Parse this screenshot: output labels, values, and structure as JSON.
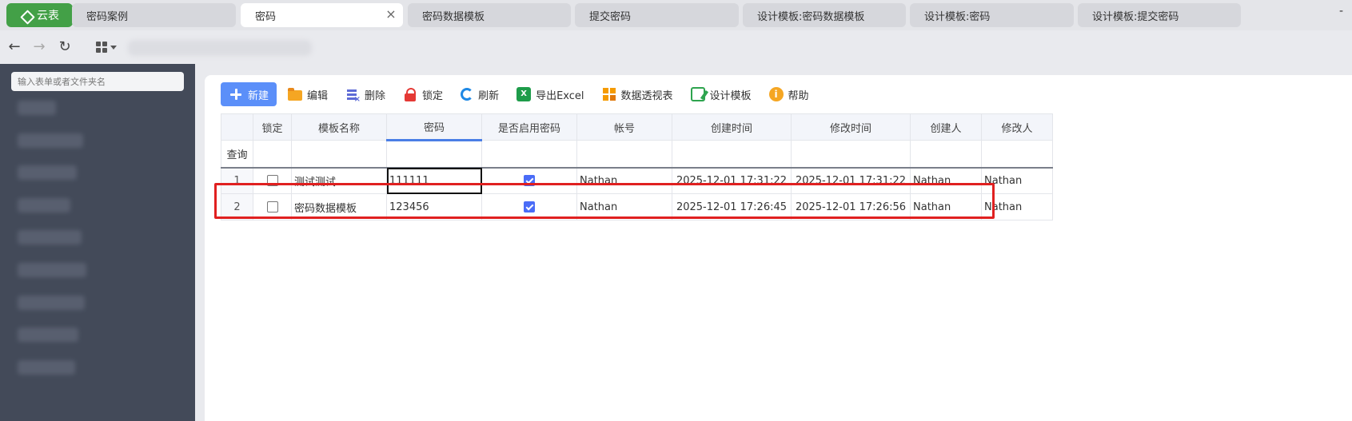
{
  "brand": {
    "label": "云表"
  },
  "tabs": [
    {
      "label": "密码案例",
      "active": false
    },
    {
      "label": "密码",
      "active": true
    },
    {
      "label": "密码数据模板",
      "active": false
    },
    {
      "label": "提交密码",
      "active": false
    },
    {
      "label": "设计模板:密码数据模板",
      "active": false
    },
    {
      "label": "设计模板:密码",
      "active": false
    },
    {
      "label": "设计模板:提交密码",
      "active": false
    }
  ],
  "tab_more": "-",
  "nav": {
    "back_icon": "back-arrow-icon",
    "forward_icon": "forward-arrow-icon",
    "reload_icon": "reload-icon",
    "apps_icon": "apps-grid-icon"
  },
  "sidebar": {
    "search_placeholder": "输入表单或者文件夹名"
  },
  "toolbar": {
    "new": "新建",
    "edit": "编辑",
    "delete": "删除",
    "lock": "锁定",
    "refresh": "刷新",
    "export": "导出Excel",
    "pivot": "数据透视表",
    "design": "设计模板",
    "help": "帮助"
  },
  "table": {
    "headers": [
      "锁定",
      "模板名称",
      "密码",
      "是否启用密码",
      "帐号",
      "创建时间",
      "修改时间",
      "创建人",
      "修改人"
    ],
    "filter_label": "查询",
    "rows": [
      {
        "num": "1",
        "locked": false,
        "name": "测试测试",
        "password": "111111",
        "enabled": true,
        "account": "Nathan",
        "created": "2025-12-01 17:31:22",
        "modified": "2025-12-01 17:31:22",
        "creator": "Nathan",
        "modifier": "Nathan"
      },
      {
        "num": "2",
        "locked": false,
        "name": "密码数据模板",
        "password": "123456",
        "enabled": true,
        "account": "Nathan",
        "created": "2025-12-01 17:26:45",
        "modified": "2025-12-01 17:26:56",
        "creator": "Nathan",
        "modifier": "Nathan"
      }
    ]
  },
  "colors": {
    "brand": "#43a047",
    "primary": "#5b8ff9",
    "highlight": "#e02020",
    "sidebar": "#434a59"
  }
}
